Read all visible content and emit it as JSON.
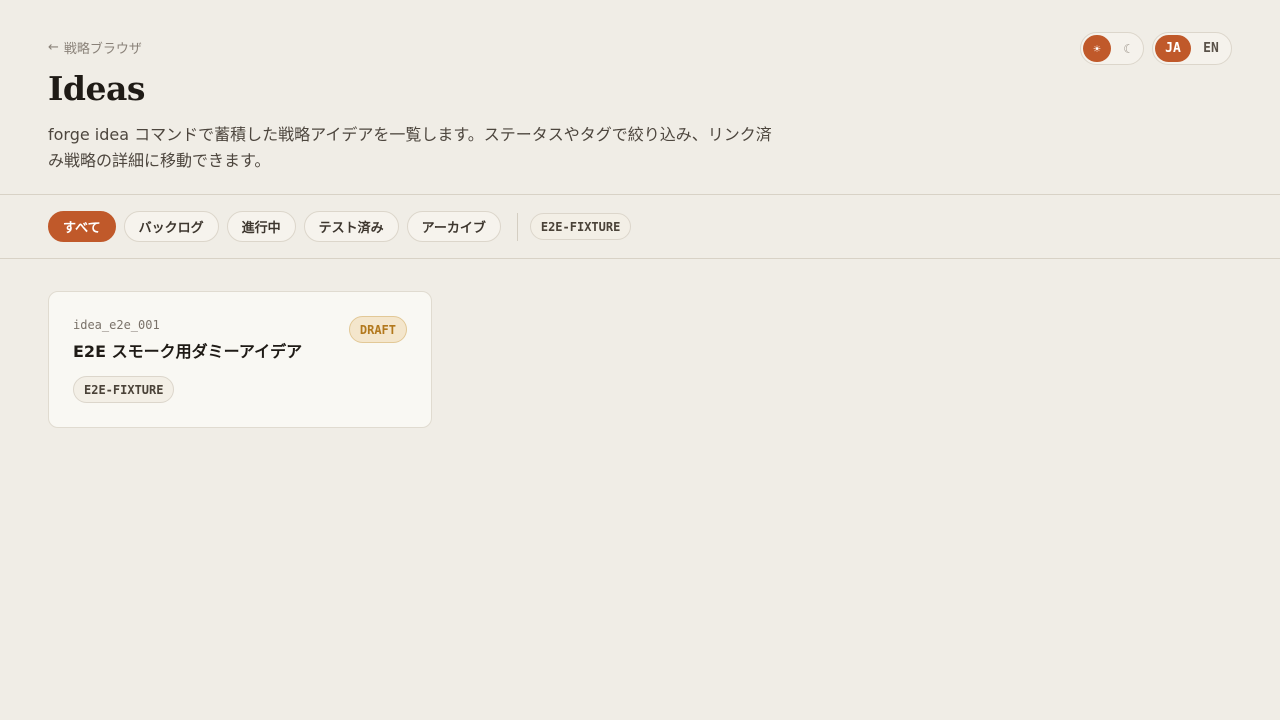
{
  "header": {
    "back_label": "戦略ブラウザ",
    "title": "Ideas",
    "description": "forge idea コマンドで蓄積した戦略アイデアを一覧します。ステータスやタグで絞り込み、リンク済み戦略の詳細に移動できます。"
  },
  "theme_toggle": {
    "light_icon": "☀",
    "dark_icon": "☾",
    "selected": "light"
  },
  "lang_toggle": {
    "ja": "JA",
    "en": "EN",
    "selected": "JA"
  },
  "filters": {
    "status": [
      "すべて",
      "バックログ",
      "進行中",
      "テスト済み",
      "アーカイブ"
    ],
    "selected_status": "すべて",
    "tags": [
      "E2E-FIXTURE"
    ]
  },
  "ideas": [
    {
      "id": "idea_e2e_001",
      "title": "E2E スモーク用ダミーアイデア",
      "status": "DRAFT",
      "tags": [
        "E2E-FIXTURE"
      ]
    }
  ],
  "colors": {
    "accent": "#c0592a",
    "background": "#f0ede6",
    "card": "#f9f8f3",
    "draft_badge_text": "#b2781c",
    "draft_badge_bg": "#f4e6cc"
  }
}
